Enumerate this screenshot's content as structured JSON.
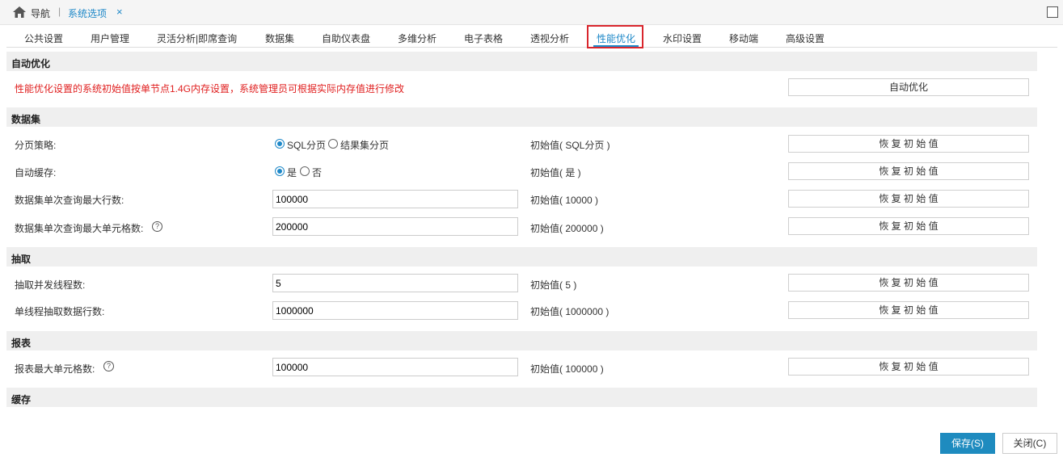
{
  "topbar": {
    "nav_label": "导航",
    "separator": "|",
    "active_tab": "系统选项",
    "close_glyph": "×"
  },
  "tabs": [
    "公共设置",
    "用户管理",
    "灵活分析|即席查询",
    "数据集",
    "自助仪表盘",
    "多维分析",
    "电子表格",
    "透视分析",
    "性能优化",
    "水印设置",
    "移动端",
    "高级设置"
  ],
  "active_tab_index": 8,
  "colors": {
    "accent": "#1e88c8",
    "warning": "#e02020",
    "highlight_frame": "#d9262d",
    "save_button": "#1e8bbf"
  },
  "sections": {
    "auto_optimize": {
      "title": "自动优化",
      "warning": "性能优化设置的系统初始值按单节点1.4G内存设置，系统管理员可根据实际内存值进行修改",
      "button": "自动优化"
    },
    "dataset": {
      "title": "数据集",
      "rows": {
        "paging": {
          "label": "分页策略:",
          "option1": "SQL分页",
          "option2": "结果集分页",
          "selected": "SQL分页",
          "initial": "初始值( SQL分页 )",
          "restore": "恢 复 初 始 值"
        },
        "autocache": {
          "label": "自动缓存:",
          "option1": "是",
          "option2": "否",
          "selected": "是",
          "initial": "初始值( 是 )",
          "restore": "恢 复 初 始 值"
        },
        "max_rows": {
          "label": "数据集单次查询最大行数:",
          "value": "100000",
          "initial": "初始值( 10000 )",
          "restore": "恢 复 初 始 值"
        },
        "max_cells": {
          "label": "数据集单次查询最大单元格数:",
          "value": "200000",
          "initial": "初始值( 200000 )",
          "restore": "恢 复 初 始 值"
        }
      }
    },
    "extract": {
      "title": "抽取",
      "rows": {
        "threads": {
          "label": "抽取并发线程数:",
          "value": "5",
          "initial": "初始值( 5 )",
          "restore": "恢 复 初 始 值"
        },
        "rows_per_thread": {
          "label": "单线程抽取数据行数:",
          "value": "1000000",
          "initial": "初始值( 1000000 )",
          "restore": "恢 复 初 始 值"
        }
      }
    },
    "report": {
      "title": "报表",
      "rows": {
        "max_cells": {
          "label": "报表最大单元格数:",
          "value": "100000",
          "initial": "初始值( 100000 )",
          "restore": "恢 复 初 始 值"
        }
      }
    },
    "cache": {
      "title": "缓存"
    }
  },
  "footer": {
    "save": "保存(S)",
    "close": "关闭(C)"
  },
  "help_glyph": "?"
}
